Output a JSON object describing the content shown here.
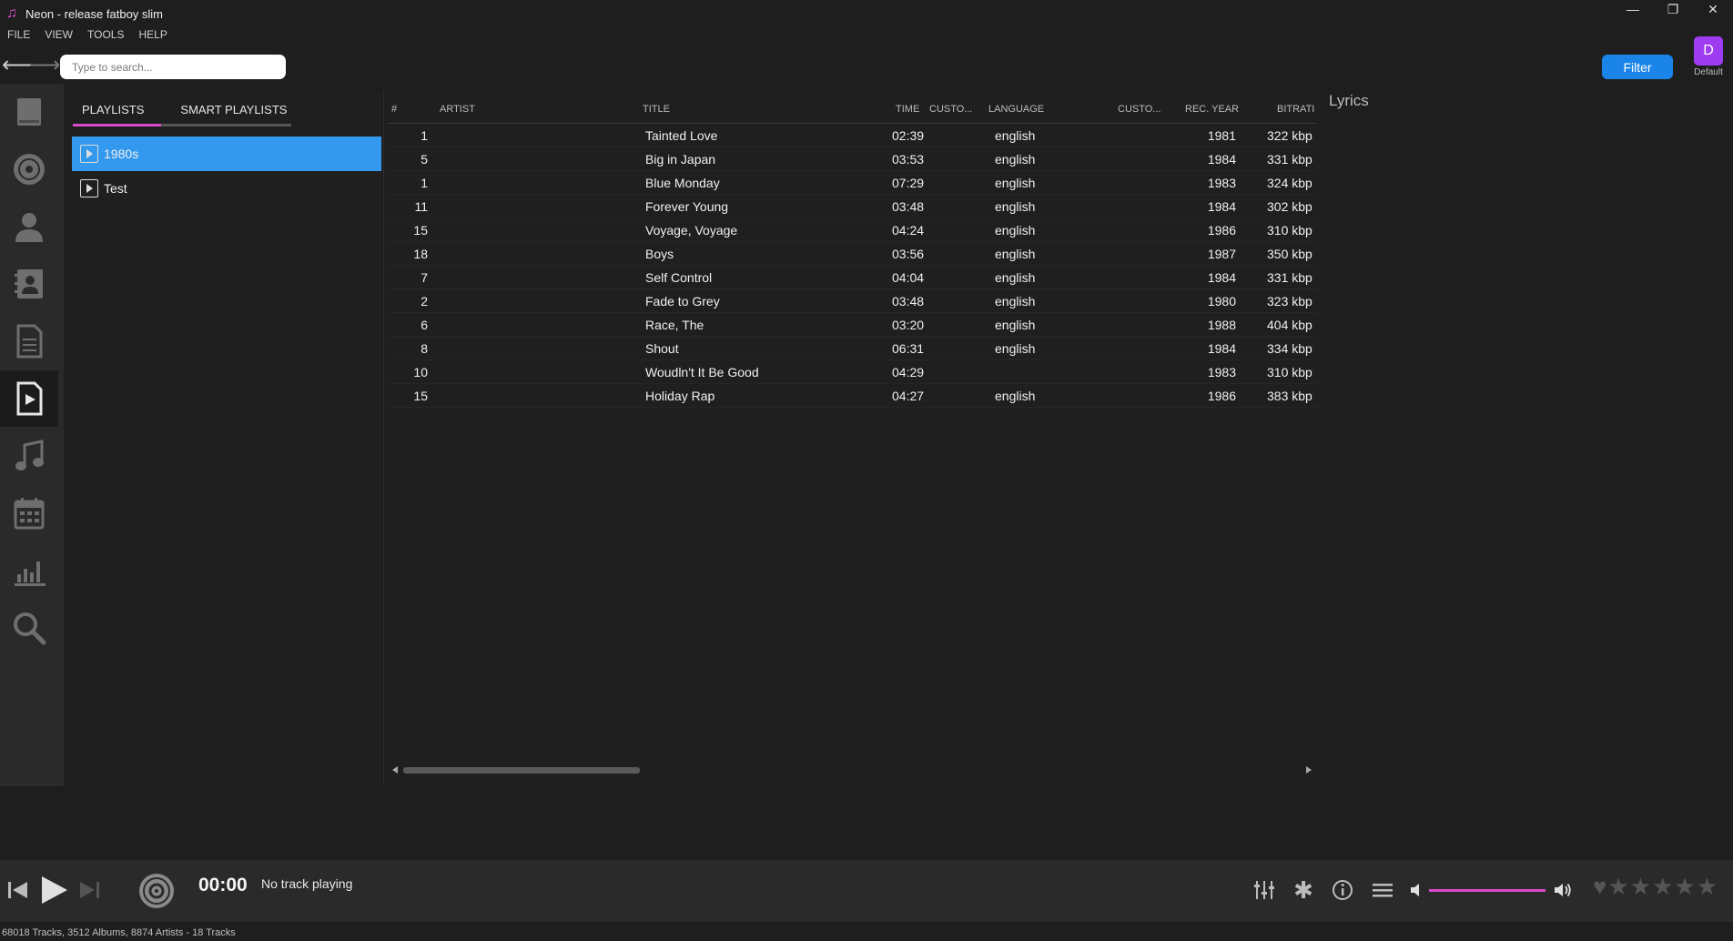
{
  "window": {
    "title": "Neon - release fatboy slim",
    "controls": {
      "minimize": "—",
      "maximize": "❐",
      "close": "✕"
    }
  },
  "menu": [
    "FILE",
    "VIEW",
    "TOOLS",
    "HELP"
  ],
  "search": {
    "placeholder": "Type to search...",
    "value": ""
  },
  "filter_label": "Filter",
  "profile": {
    "initial": "D",
    "label": "Default"
  },
  "rail": {
    "items": [
      "library-icon",
      "disc-icon",
      "artist-icon",
      "contact-card-icon",
      "document-icon",
      "playlist-icon",
      "music-note-icon",
      "calendar-icon",
      "chart-icon",
      "search-icon"
    ],
    "active": "playlist-icon"
  },
  "playlists": {
    "tabs": [
      "PLAYLISTS",
      "SMART PLAYLISTS"
    ],
    "active_tab": "PLAYLISTS",
    "items": [
      "1980s",
      "Test"
    ],
    "selected": "1980s",
    "accent_color": "#d94ac8",
    "selection_color": "#3399ee"
  },
  "table": {
    "headers": {
      "num": "#",
      "artist": "ARTIST",
      "title": "TITLE",
      "time": "TIME",
      "custom1": "CUSTO...",
      "language": "LANGUAGE",
      "custom2": "CUSTO...",
      "year": "REC. YEAR",
      "bitrate": "BITRATI"
    },
    "rows": [
      {
        "num": "1",
        "title": "Tainted Love",
        "time": "02:39",
        "language": "english",
        "year": "1981",
        "bitrate": "322 kbp"
      },
      {
        "num": "5",
        "title": "Big in Japan",
        "time": "03:53",
        "language": "english",
        "year": "1984",
        "bitrate": "331 kbp"
      },
      {
        "num": "1",
        "title": "Blue Monday",
        "time": "07:29",
        "language": "english",
        "year": "1983",
        "bitrate": "324 kbp"
      },
      {
        "num": "11",
        "title": "Forever Young",
        "time": "03:48",
        "language": "english",
        "year": "1984",
        "bitrate": "302 kbp"
      },
      {
        "num": "15",
        "title": "Voyage, Voyage",
        "time": "04:24",
        "language": "english",
        "year": "1986",
        "bitrate": "310 kbp"
      },
      {
        "num": "18",
        "title": "Boys",
        "time": "03:56",
        "language": "english",
        "year": "1987",
        "bitrate": "350 kbp"
      },
      {
        "num": "7",
        "title": "Self Control",
        "time": "04:04",
        "language": "english",
        "year": "1984",
        "bitrate": "331 kbp"
      },
      {
        "num": "2",
        "title": "Fade to Grey",
        "time": "03:48",
        "language": "english",
        "year": "1980",
        "bitrate": "323 kbp"
      },
      {
        "num": "6",
        "title": "Race, The",
        "time": "03:20",
        "language": "english",
        "year": "1988",
        "bitrate": "404 kbp"
      },
      {
        "num": "8",
        "title": "Shout",
        "time": "06:31",
        "language": "english",
        "year": "1984",
        "bitrate": "334 kbp"
      },
      {
        "num": "10",
        "title": "Woudln't It Be Good",
        "time": "04:29",
        "language": "",
        "year": "1983",
        "bitrate": "310 kbp"
      },
      {
        "num": "15",
        "title": "Holiday Rap",
        "time": "04:27",
        "language": "english",
        "year": "1986",
        "bitrate": "383 kbp"
      }
    ]
  },
  "lyrics": {
    "title": "Lyrics"
  },
  "player": {
    "time": "00:00",
    "status": "No track playing",
    "volume_fraction": 1.0,
    "rating_stars": 0,
    "rating_max": 5
  },
  "statusbar": "68018 Tracks, 3512 Albums, 8874 Artists - 18 Tracks"
}
